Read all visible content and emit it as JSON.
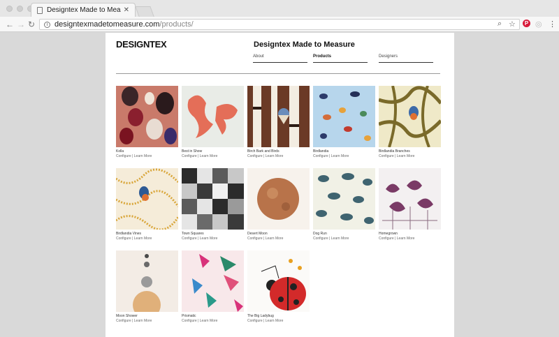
{
  "browser": {
    "tab_title": "Designtex Made to Measure | D",
    "url_host": "designtexmadetomeasure.com",
    "url_path": "/products/"
  },
  "site": {
    "logo": "DESIGNTEX",
    "title": "Designtex Made to Measure",
    "nav": [
      {
        "label": "About"
      },
      {
        "label": "Products"
      },
      {
        "label": "Designers"
      }
    ]
  },
  "actions": {
    "configure": "Configure",
    "sep": "|",
    "learn": "Learn More"
  },
  "products": [
    {
      "name": "Kolla"
    },
    {
      "name": "Best in Show"
    },
    {
      "name": "Birch Bark and Birds"
    },
    {
      "name": "Birdlandia"
    },
    {
      "name": "Birdlandia Branches"
    },
    {
      "name": "Birdlandia Vines"
    },
    {
      "name": "Town Squares"
    },
    {
      "name": "Desert Moon"
    },
    {
      "name": "Dog Run"
    },
    {
      "name": "Homegrown"
    },
    {
      "name": "Moon Shower"
    },
    {
      "name": "Prismatic"
    },
    {
      "name": "The Big Ladybug"
    }
  ]
}
